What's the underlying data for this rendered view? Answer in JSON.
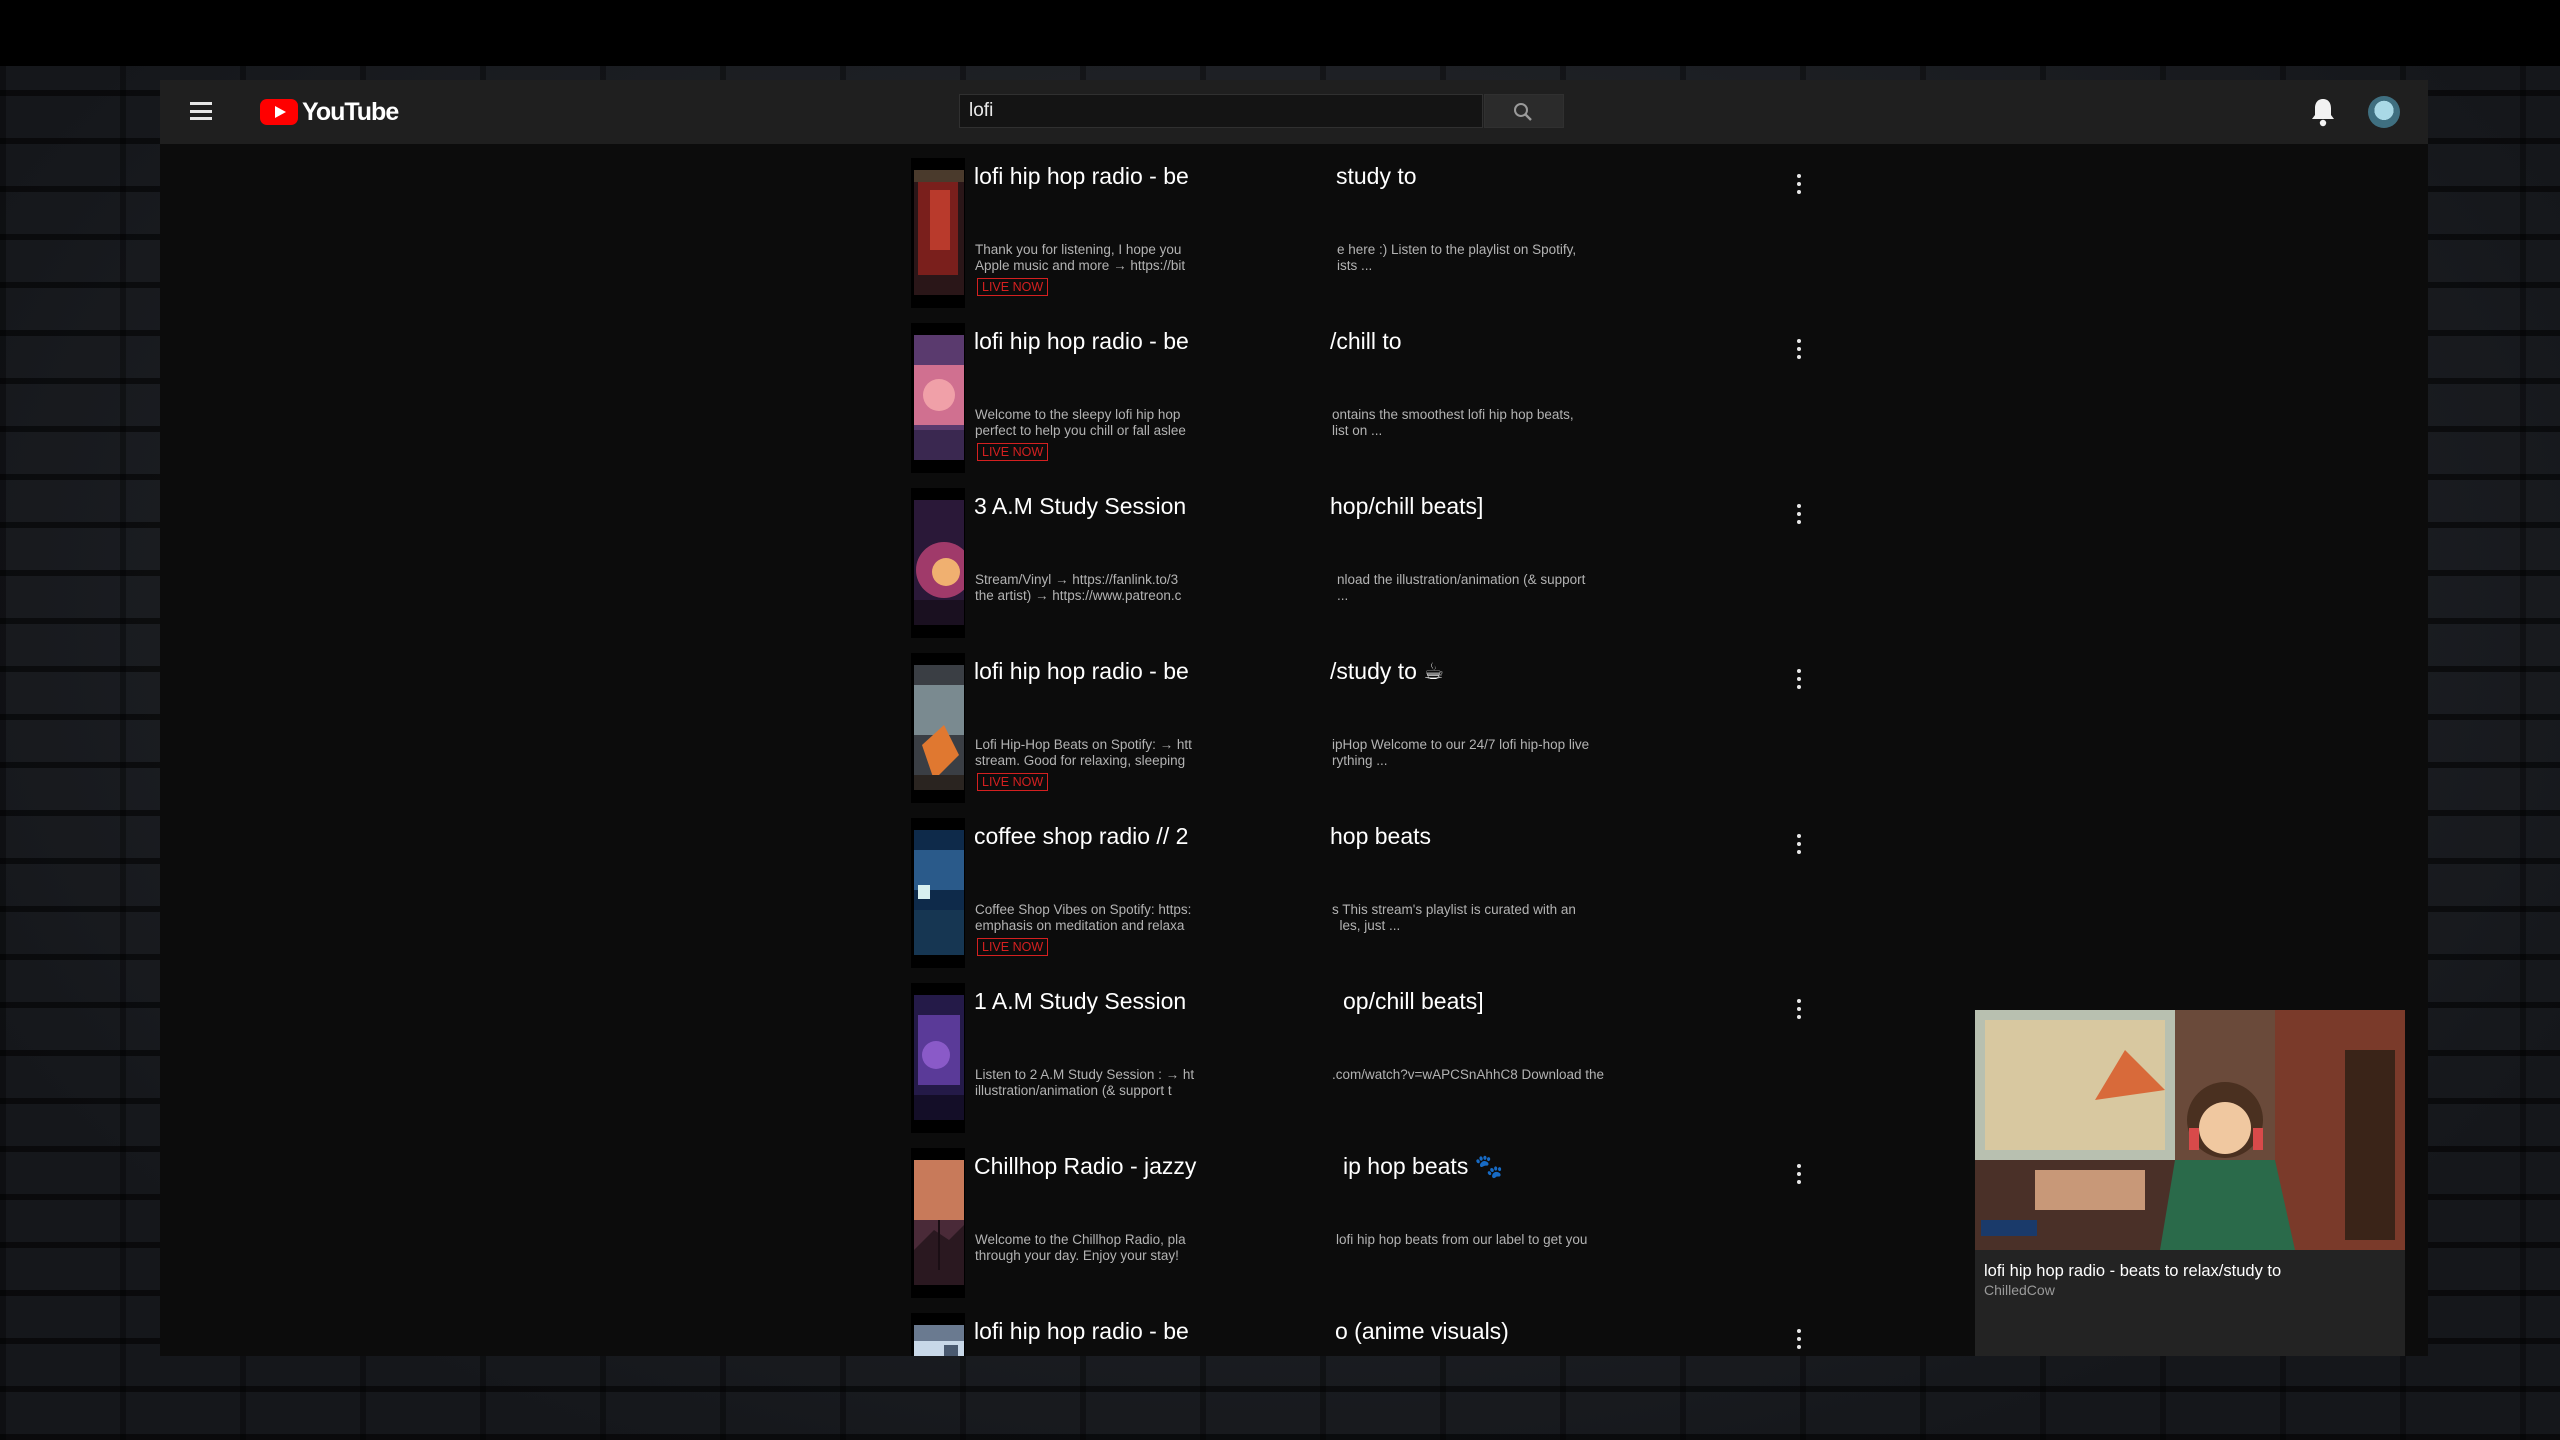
{
  "header": {
    "logo_text": "YouTube",
    "search_value": "lofi"
  },
  "results": [
    {
      "title_left": "lofi hip hop radio - be",
      "title_right": "study to",
      "desc_left": "Thank you for listening, I hope you\nApple music and more → https://bit",
      "desc_right": "e here :) Listen to the playlist on Spotify,\nists ...",
      "badge": "LIVE NOW"
    },
    {
      "title_left": "lofi hip hop radio - be",
      "title_right": "/chill to",
      "desc_left": "Welcome to the sleepy lofi hip hop\nperfect to help you chill or fall aslee",
      "desc_right": "ontains the smoothest lofi hip hop beats,\nlist on ...",
      "badge": "LIVE NOW"
    },
    {
      "title_left": "3 A.M Study Session",
      "title_right": "hop/chill beats]",
      "desc_left": "Stream/Vinyl → https://fanlink.to/3\nthe artist) → https://www.patreon.c",
      "desc_right": "nload the illustration/animation (& support\n...",
      "badge": ""
    },
    {
      "title_left": "lofi hip hop radio - be",
      "title_right": "/study to ☕︎",
      "desc_left": "Lofi Hip-Hop Beats on Spotify: → htt\nstream. Good for relaxing, sleeping",
      "desc_right": "ipHop Welcome to our 24/7 lofi hip-hop live\nrything ...",
      "badge": "LIVE NOW"
    },
    {
      "title_left": "coffee shop radio // 2",
      "title_right": "hop beats",
      "desc_left": "Coffee Shop Vibes on Spotify: https:\nemphasis on meditation and relaxa",
      "desc_right": "s This stream's playlist is curated with an\n  les, just ...",
      "badge": "LIVE NOW"
    },
    {
      "title_left": "1 A.M Study Session",
      "title_right": "op/chill beats]",
      "desc_left": "Listen to 2 A.M Study Session : → ht\nillustration/animation (& support t",
      "desc_right": ".com/watch?v=wAPCSnAhhC8 Download the",
      "badge": ""
    },
    {
      "title_left": "Chillhop Radio - jazzy",
      "title_right": "ip hop beats 🐾",
      "desc_left": "Welcome to the Chillhop Radio, pla\nthrough your day. Enjoy your stay!",
      "desc_right": "lofi hip hop beats from our label to get you",
      "badge": ""
    },
    {
      "title_left": "lofi hip hop radio - be",
      "title_right": "o (anime visuals)",
      "desc_left": "",
      "desc_right": "",
      "badge": ""
    }
  ],
  "miniplayer": {
    "title": "lofi hip hop radio - beats to relax/study to",
    "channel": "ChilledCow"
  },
  "colors": {
    "brand_red": "#ff0000",
    "live_red": "#d42020",
    "masthead_bg": "#1f1f1f",
    "page_bg": "#0c0c0c"
  }
}
